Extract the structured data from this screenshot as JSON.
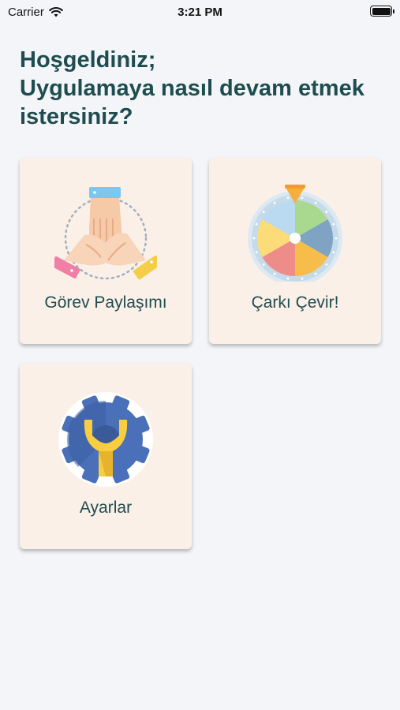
{
  "status_bar": {
    "carrier": "Carrier",
    "time": "3:21 PM",
    "wifi_icon": "wifi-icon",
    "battery_icon": "battery-icon"
  },
  "welcome": {
    "greeting": "Hoşgeldiniz;",
    "question": "Uygulamaya nasıl devam etmek istersiniz?"
  },
  "menu": {
    "task_sharing": {
      "label": "Görev Paylaşımı",
      "icon": "stacked-hands-icon"
    },
    "spin_wheel": {
      "label": "Çarkı Çevir!",
      "icon": "prize-wheel-icon"
    },
    "settings": {
      "label": "Ayarlar",
      "icon": "gear-wrench-icon"
    }
  },
  "colors": {
    "background": "#f3f5f9",
    "card": "#fbf0e8",
    "text": "#1f4d4f"
  }
}
